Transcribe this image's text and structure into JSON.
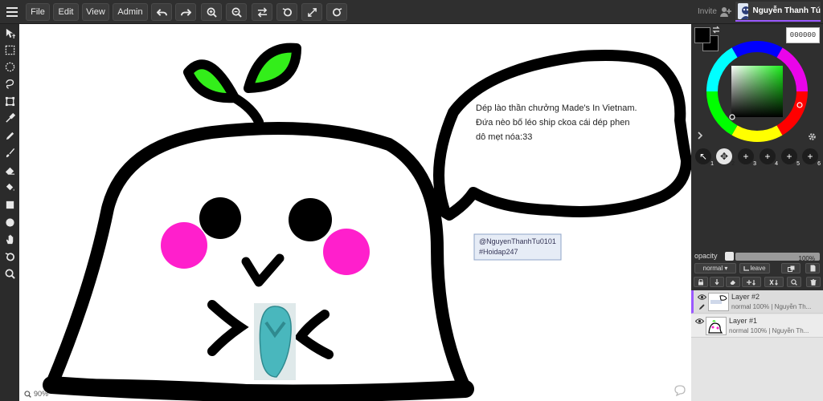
{
  "menu": {
    "file": "File",
    "edit": "Edit",
    "view": "View",
    "admin": "Admin"
  },
  "header": {
    "invite": "Invite",
    "user_name": "Nguyễn Thanh Tú",
    "accent_color": "#9b59ff"
  },
  "canvas": {
    "zoom": "90%",
    "speech_line1": "Dép lào thần chưởng Made's In Vietnam.",
    "speech_line2": "Đứa nèo bố léo ship ckoa cái dép phen",
    "speech_line3": "dô mẹt nóa:33",
    "watermark_line1": "@NguyenThanhTu0101",
    "watermark_line2": "#Hoidap247",
    "colors": {
      "leaf": "#33ee1a",
      "cheek": "#ff1fcc",
      "outline": "#000000",
      "sandal": "#49b7bd"
    }
  },
  "color_panel": {
    "hex": "000000",
    "primary": "#000000"
  },
  "brushes": [
    "1",
    "2",
    "3",
    "4",
    "5",
    "6"
  ],
  "layers_panel": {
    "opacity_label": "opacity",
    "opacity_value": "100%",
    "blend_mode": "normal ▾",
    "leave_label": "leave",
    "layers": [
      {
        "name": "Layer #2",
        "info": "normal 100% | Nguyễn Th..."
      },
      {
        "name": "Layer #1",
        "info": "normal 100% | Nguyễn Th..."
      }
    ]
  }
}
